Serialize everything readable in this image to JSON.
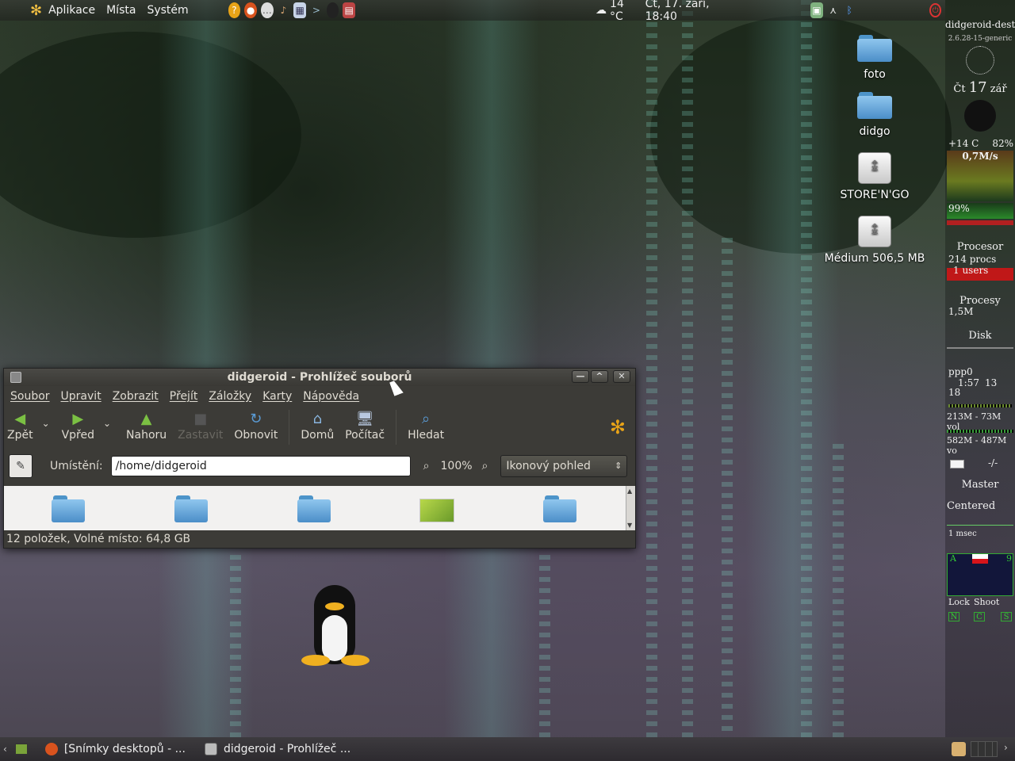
{
  "top_panel": {
    "menu": [
      "Aplikace",
      "Místa",
      "Systém"
    ],
    "weather": "14 °C",
    "datetime": "Čt, 17. září, 18:40",
    "launcher_icons": [
      "help-icon",
      "firefox-icon",
      "chat-icon",
      "guitar-icon",
      "screenshot-icon",
      "terminal-icon",
      "media-icon",
      "clipboard-icon"
    ],
    "tray_icons": [
      "network-icon",
      "antenna-icon",
      "bluetooth-icon",
      "shutdown-icon"
    ]
  },
  "desktop_icons": [
    {
      "label": "foto",
      "type": "folder"
    },
    {
      "label": "didgo",
      "type": "folder"
    },
    {
      "label": "STORE'N'GO",
      "type": "drive"
    },
    {
      "label": "Médium 506,5 MB",
      "type": "drive"
    }
  ],
  "conky": {
    "host": "didgeroid-destr",
    "kernel": "2.6.28-15-generic",
    "date_day": "Čt",
    "date_num": "17",
    "date_month": "zář",
    "temp": "+14 C",
    "percent": "82%",
    "net_speed": "0,7M/s",
    "cpu_pct": "99%",
    "procesor_label": "Procesor",
    "procs": "214 procs",
    "users": "1 users",
    "procesy_label": "Procesy",
    "procesy_val": "1,5M",
    "disk_label": "Disk",
    "ppp_label": "ppp0",
    "ppp_time": "1:57",
    "ppp_val1": "13",
    "ppp_val2": "18",
    "net_vol": "213M - 73M vol",
    "mem_vol": "582M - 487M vo",
    "mail_val": "-/-",
    "master_label": "Master",
    "centered_label": "Centered",
    "timer_label": "1 msec",
    "desk_letters": [
      "A",
      "9"
    ],
    "lock_label": "Lock",
    "shoot_label": "Shoot",
    "bottom_letters": [
      "N",
      "C",
      "S"
    ]
  },
  "file_manager": {
    "title": "didgeroid - Prohlížeč souborů",
    "menubar": [
      "Soubor",
      "Upravit",
      "Zobrazit",
      "Přejít",
      "Záložky",
      "Karty",
      "Nápověda"
    ],
    "toolbar": {
      "back": "Zpět",
      "forward": "Vpřed",
      "up": "Nahoru",
      "stop": "Zastavit",
      "reload": "Obnovit",
      "home": "Domů",
      "computer": "Počítač",
      "search": "Hledat"
    },
    "location_label": "Umístění:",
    "location_value": "/home/didgeroid",
    "zoom": "100%",
    "view_mode": "Ikonový pohled",
    "status": "12 položek, Volné místo: 64,8 GB",
    "items": [
      "folder",
      "folder",
      "folder",
      "image",
      "folder"
    ]
  },
  "bottom_panel": {
    "tasks": [
      "[Snímky desktopů - ...",
      "didgeroid - Prohlížeč ..."
    ]
  }
}
